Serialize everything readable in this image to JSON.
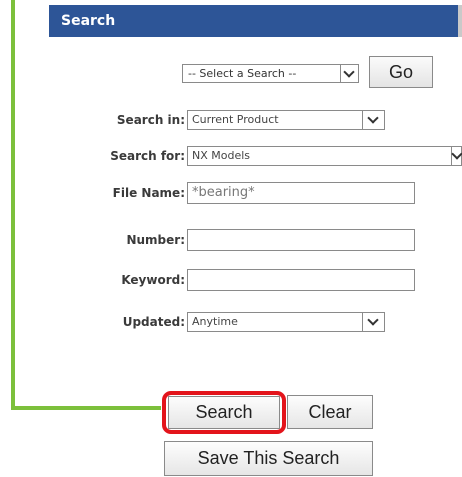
{
  "panel": {
    "title": "Search"
  },
  "saved_search": {
    "selected": "-- Select a Search --",
    "go_label": "Go"
  },
  "fields": {
    "search_in_label": "Search in:",
    "search_in_value": "Current Product",
    "search_for_label": "Search for:",
    "search_for_value": "NX Models",
    "file_name_label": "File Name:",
    "file_name_value": "*bearing*",
    "number_label": "Number:",
    "number_value": "",
    "keyword_label": "Keyword:",
    "keyword_value": "",
    "updated_label": "Updated:",
    "updated_value": "Anytime"
  },
  "buttons": {
    "search_label": "Search",
    "clear_label": "Clear",
    "save_label": "Save This Search"
  },
  "colors": {
    "header_bg": "#2d5597",
    "callout_line": "#7cc03b",
    "highlight_border": "#e3141b"
  },
  "icons": {
    "dropdown": "chevron-down-icon"
  }
}
